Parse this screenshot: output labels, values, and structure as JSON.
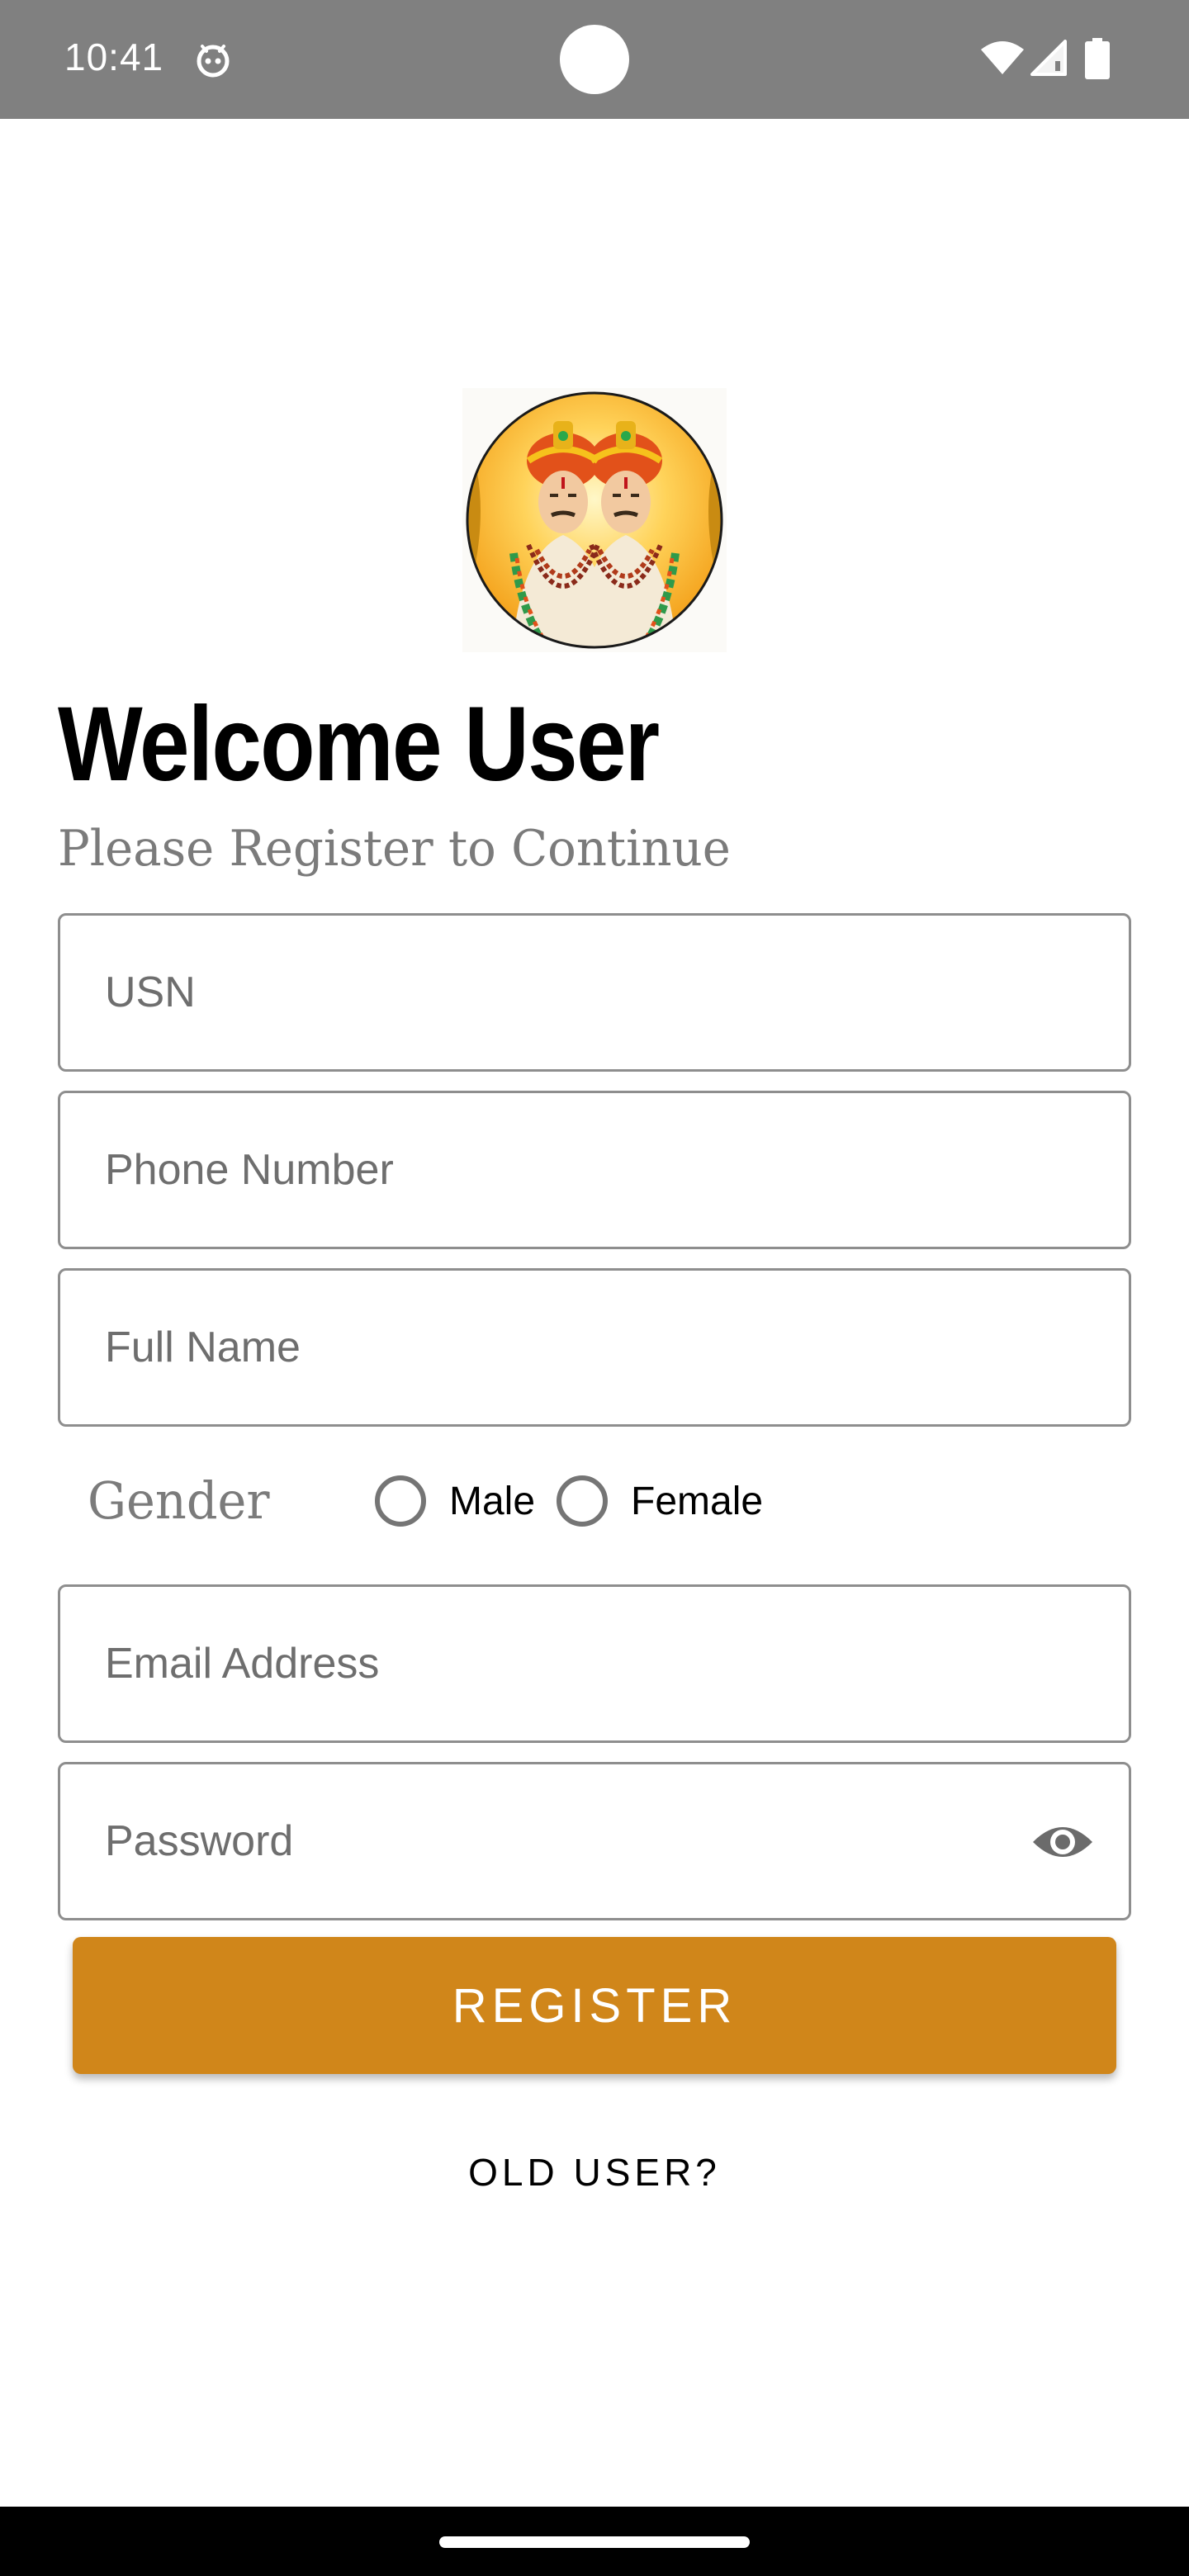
{
  "status_bar": {
    "time": "10:41",
    "app_icon": "android-face-icon",
    "indicators": [
      "wifi-icon",
      "signal-icon",
      "battery-icon"
    ]
  },
  "logo": {
    "name": "deity-portrait-logo"
  },
  "header": {
    "title": "Welcome User",
    "subtitle": "Please Register to Continue"
  },
  "form": {
    "usn": {
      "placeholder": "USN",
      "value": ""
    },
    "phone": {
      "placeholder": "Phone Number",
      "value": ""
    },
    "full_name": {
      "placeholder": "Full Name",
      "value": ""
    },
    "gender": {
      "label": "Gender",
      "options": [
        "Male",
        "Female"
      ],
      "selected": null
    },
    "email": {
      "placeholder": "Email Address",
      "value": ""
    },
    "password": {
      "placeholder": "Password",
      "value": "",
      "toggle_icon": "eye-icon"
    }
  },
  "actions": {
    "register_label": "REGISTER",
    "old_user_label": "OLD USER?"
  },
  "colors": {
    "status_bar": "#808080",
    "accent": "#d0861a",
    "field_border": "#8e8e8e",
    "subtle_text": "#7b7b7b"
  }
}
